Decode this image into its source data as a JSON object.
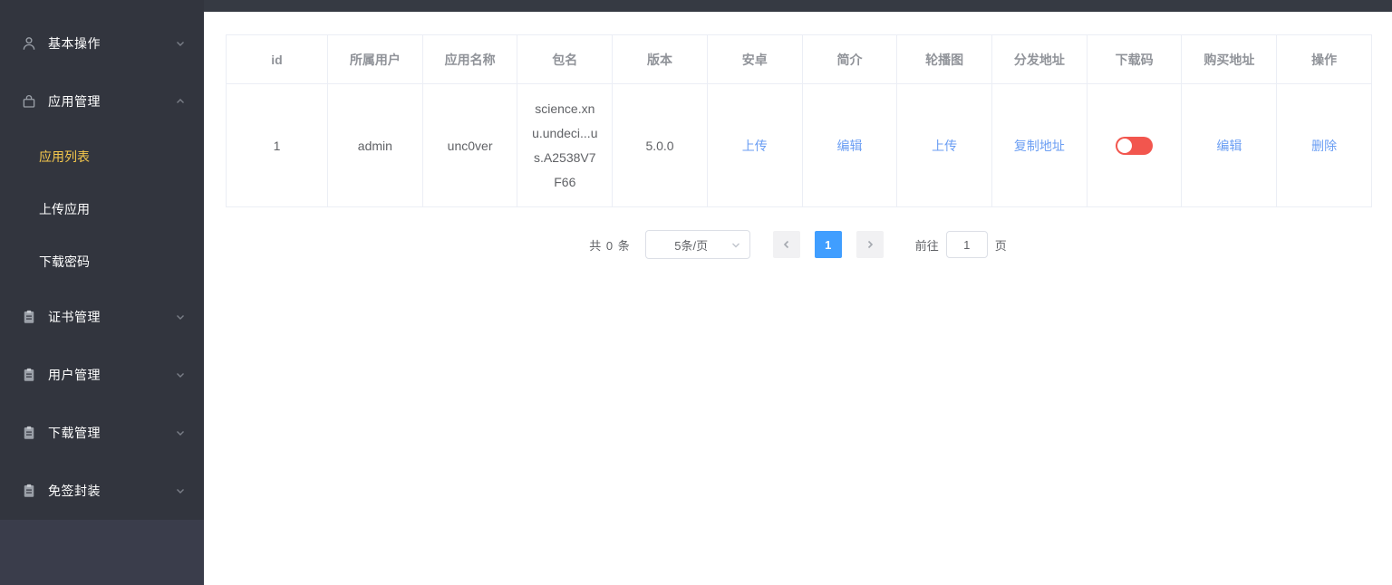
{
  "colors": {
    "accent": "#409eff",
    "link": "#6b9ef3",
    "switch_on": "#f2564e",
    "sidebar_active": "#f5c84c"
  },
  "sidebar": {
    "items": [
      {
        "icon": "user-icon",
        "label": "基本操作",
        "state": "collapsed"
      },
      {
        "icon": "bag-icon",
        "label": "应用管理",
        "state": "expanded",
        "children": [
          {
            "label": "应用列表",
            "active": true
          },
          {
            "label": "上传应用",
            "active": false
          },
          {
            "label": "下载密码",
            "active": false
          }
        ]
      },
      {
        "icon": "clipboard-icon",
        "label": "证书管理",
        "state": "collapsed"
      },
      {
        "icon": "clipboard-icon",
        "label": "用户管理",
        "state": "collapsed"
      },
      {
        "icon": "clipboard-icon",
        "label": "下载管理",
        "state": "collapsed"
      },
      {
        "icon": "clipboard-icon",
        "label": "免签封装",
        "state": "collapsed"
      }
    ]
  },
  "table": {
    "headers": [
      "id",
      "所属用户",
      "应用名称",
      "包名",
      "版本",
      "安卓",
      "简介",
      "轮播图",
      "分发地址",
      "下载码",
      "购买地址",
      "操作"
    ],
    "row": {
      "id": "1",
      "owner": "admin",
      "app_name": "unc0ver",
      "package": "science.xnu.undeci...us.A2538V7F66",
      "version": "5.0.0",
      "android_action": "上传",
      "intro_action": "编辑",
      "carousel_action": "上传",
      "distribute_action": "复制地址",
      "download_code_enabled": true,
      "purchase_action": "编辑",
      "delete_action": "删除"
    }
  },
  "pagination": {
    "total": "共 0 条",
    "page_size": "5条/页",
    "current_page": "1",
    "goto_label": "前往",
    "goto_value": "1",
    "page_unit": "页"
  }
}
